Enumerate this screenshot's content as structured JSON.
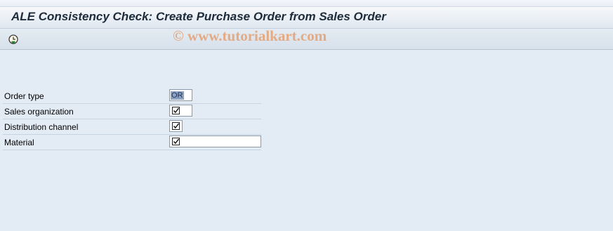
{
  "window": {
    "title": "ALE Consistency Check: Create Purchase Order from Sales Order"
  },
  "toolbar": {
    "execute_icon": "execute-clock-icon"
  },
  "watermark": "© www.tutorialkart.com",
  "form": {
    "fields": [
      {
        "label": "Order type",
        "value": "OR",
        "type": "text"
      },
      {
        "label": "Sales organization",
        "value": "",
        "type": "checkbox",
        "checked": true
      },
      {
        "label": "Distribution channel",
        "value": "",
        "type": "checkbox",
        "checked": true
      },
      {
        "label": "Material",
        "value": "",
        "type": "checkbox",
        "checked": true
      }
    ]
  }
}
